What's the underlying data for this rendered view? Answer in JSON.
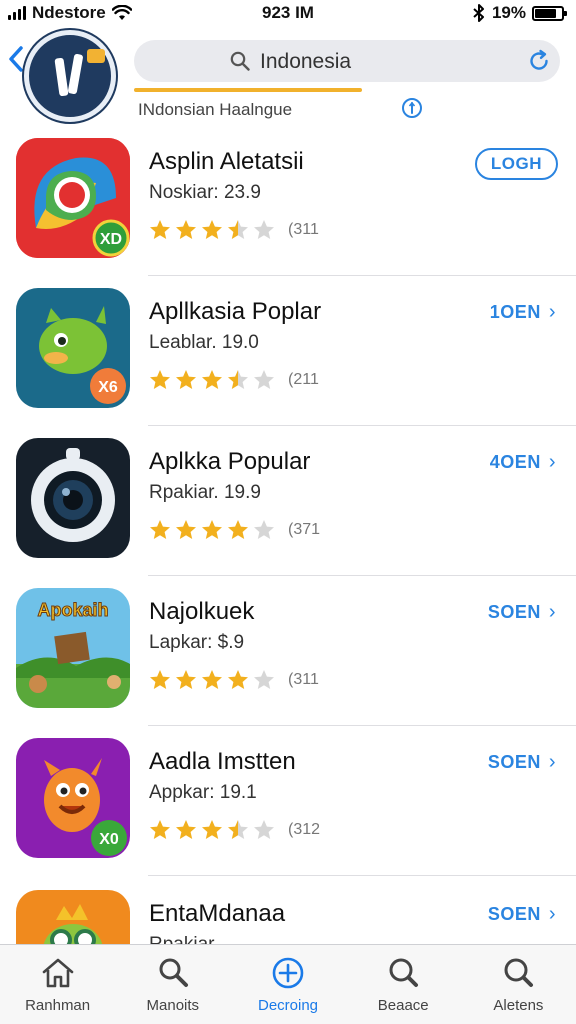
{
  "status_bar": {
    "carrier": "Ndestore",
    "time": "923 IM",
    "battery": "19%",
    "battery_level": 0.8
  },
  "header": {
    "logo_icon": "app-store-logo-icon",
    "search_text": "Indonesia",
    "subtitle": "INdonsian  Haalngue",
    "accent_color": "#f1b12c"
  },
  "apps": [
    {
      "name": "Asplin Aletatsii",
      "sub": "Noskiar: 23.9",
      "rating_count": "(311",
      "stars": 3.5,
      "action": "LOGH",
      "action_style": "button",
      "badge": "XD"
    },
    {
      "name": "Apllkasia Poplar",
      "sub": "Leablar. 19.0",
      "rating_count": "(211",
      "stars": 3.5,
      "action": "1OEN",
      "action_style": "link",
      "badge": "X6"
    },
    {
      "name": "Aplkka Popular",
      "sub": "Rpakiar. 19.9",
      "rating_count": "(371",
      "stars": 4,
      "action": "4OEN",
      "action_style": "link",
      "badge": ""
    },
    {
      "name": "Najolkuek",
      "sub": "Lapkar: $.9",
      "rating_count": "(311",
      "stars": 4,
      "action": "SOEN",
      "action_style": "link",
      "badge": "",
      "icon_text": "Apokaih"
    },
    {
      "name": "Aadla Imstten",
      "sub": "Appkar: 19.1",
      "rating_count": "(312",
      "stars": 3.5,
      "action": "SOEN",
      "action_style": "link",
      "badge": "X0"
    },
    {
      "name": "EntaMdanaa",
      "sub": "Rpakiar.",
      "rating_count": "",
      "stars": 0,
      "action": "SOEN",
      "action_style": "link",
      "badge": ""
    }
  ],
  "tabs": [
    {
      "label": "Ranhman",
      "icon": "home-icon",
      "active": false
    },
    {
      "label": "Manoits",
      "icon": "search-icon",
      "active": false
    },
    {
      "label": "Decroing",
      "icon": "plus-circle-icon",
      "active": true
    },
    {
      "label": "Beaace",
      "icon": "search-icon",
      "active": false
    },
    {
      "label": "Aletens",
      "icon": "search-icon",
      "active": false
    }
  ],
  "colors": {
    "accent": "#2a84e0",
    "star": "#f2b01e"
  }
}
